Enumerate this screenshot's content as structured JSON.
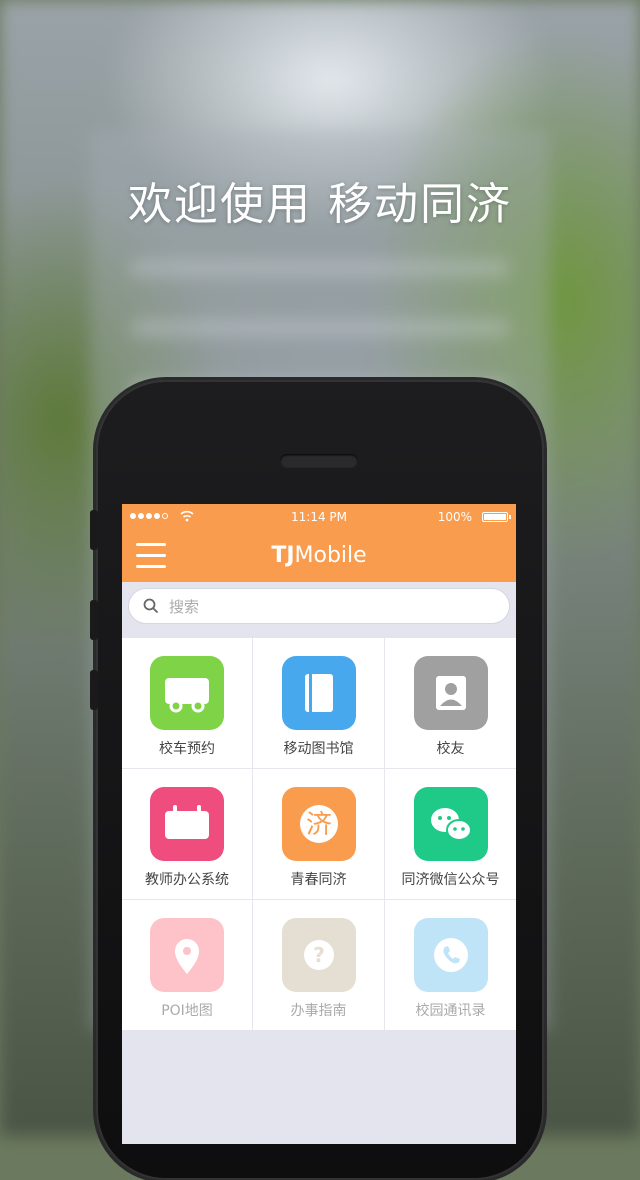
{
  "welcome_text": "欢迎使用 移动同济",
  "statusbar": {
    "time": "11:14 PM",
    "battery": "100%"
  },
  "navbar": {
    "title_bold": "TJ",
    "title_rest": "Mobile"
  },
  "search": {
    "placeholder": "搜索"
  },
  "apps": [
    {
      "label": "校车预约",
      "icon": "bus-icon",
      "color": "#7ed347",
      "enabled": true
    },
    {
      "label": "移动图书馆",
      "icon": "book-icon",
      "color": "#48a8ee",
      "enabled": true
    },
    {
      "label": "校友",
      "icon": "person-icon",
      "color": "#a0a0a0",
      "enabled": true
    },
    {
      "label": "教师办公系统",
      "icon": "calendar-icon",
      "color": "#ef4d7e",
      "enabled": true
    },
    {
      "label": "青春同济",
      "icon": "ji-character-icon",
      "color": "#f99c4e",
      "enabled": true,
      "glyph": "济"
    },
    {
      "label": "同济微信公众号",
      "icon": "wechat-icon",
      "color": "#1fc988",
      "enabled": true
    },
    {
      "label": "POI地图",
      "icon": "map-pin-icon",
      "color": "#fdc3c9",
      "enabled": false
    },
    {
      "label": "办事指南",
      "icon": "question-icon",
      "color": "#e5ded2",
      "enabled": false
    },
    {
      "label": "校园通讯录",
      "icon": "phone-icon",
      "color": "#bfe3f7",
      "enabled": false
    }
  ]
}
